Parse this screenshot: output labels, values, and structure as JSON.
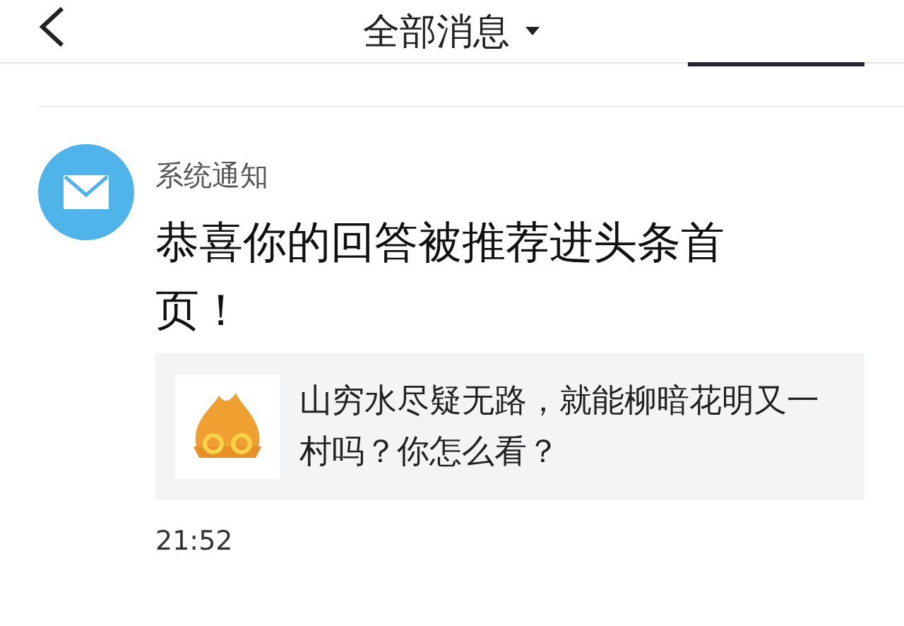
{
  "header": {
    "title": "全部消息"
  },
  "message": {
    "sender": "系统通知",
    "text": "恭喜你的回答被推荐进头条首页！",
    "attachment": {
      "text": "山穷水尽疑无路，就能柳暗花明又一村吗？你怎么看？"
    },
    "time": "21:52"
  }
}
